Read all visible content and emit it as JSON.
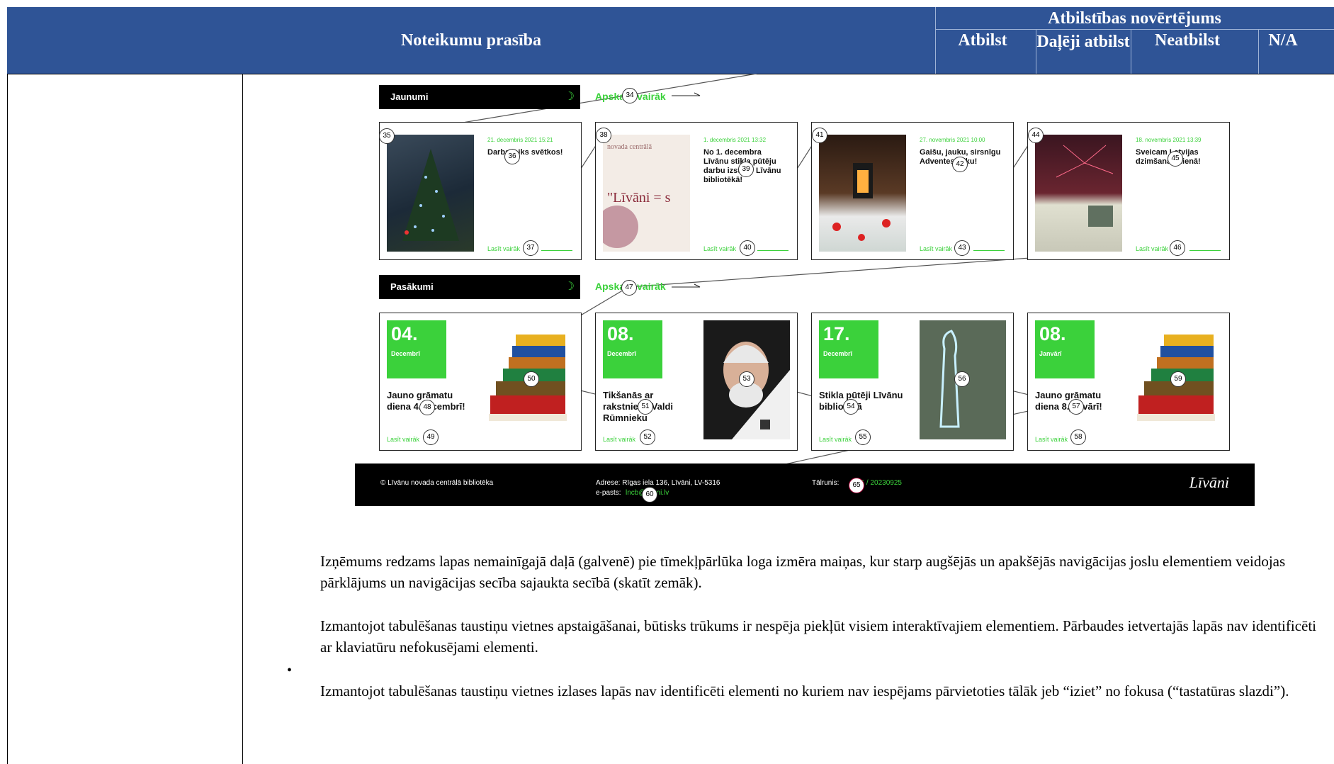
{
  "table_header": {
    "requirement": "Noteikumu prasība",
    "assessment": "Atbilstības novērtējums",
    "col_complies": "Atbilst",
    "col_partial": "Daļēji atbilst",
    "col_not": "Neatbilst",
    "col_na": "N/A"
  },
  "screenshot": {
    "news": {
      "section_label": "Jaunumi",
      "more_label": "Apskatīt vairāk",
      "cards": [
        {
          "date": "21. decembris 2021 15:21",
          "title": "Darba laiks svētkos!",
          "read_more": "Lasīt vairāk"
        },
        {
          "date": "1. decembris 2021 13:32",
          "title": "No 1. decembra Līvānu stikla pūtēju darbu izstāde Līvānu bibliotēkā!",
          "read_more": "Lasīt vairāk"
        },
        {
          "date": "27. novembris 2021 10:00",
          "title": "Gaišu, jauku, sirsnīgu Adventes laiku!",
          "read_more": "Lasīt vairāk"
        },
        {
          "date": "18. novembris 2021 13:39",
          "title": "Sveicam Latvijas dzimšanas dienā!",
          "read_more": "Lasīt vairāk"
        }
      ]
    },
    "events": {
      "section_label": "Pasākumi",
      "more_label": "Apskatīt vairāk",
      "cards": [
        {
          "day": "04.",
          "month": "Decembrī",
          "title": "Jauno grāmatu diena 4.decembrī!",
          "read_more": "Lasīt vairāk"
        },
        {
          "day": "08.",
          "month": "Decembrī",
          "title": "Tikšanās ar rakstnieku Valdi Rūmnieku",
          "read_more": "Lasīt vairāk"
        },
        {
          "day": "17.",
          "month": "Decembrī",
          "title": "Stikla pūtēji Līvānu bibliotēkā",
          "read_more": "Lasīt vairāk"
        },
        {
          "day": "08.",
          "month": "Janvārī",
          "title": "Jauno grāmatu diena 8.janvārī!",
          "read_more": "Lasīt vairāk"
        }
      ]
    },
    "footer": {
      "copyright": "© Līvānu novada centrālā bibliotēka",
      "address": "Adrese: Rīgas iela 136, Līvāni, LV-5316",
      "email_label": "e-pasts:",
      "email": "lncb@livani.lv",
      "phone_label": "Tālrunis:",
      "phone_tail": "85 / 20230925",
      "logo_text": "Līvāni"
    },
    "markers": [
      "34",
      "35",
      "36",
      "37",
      "38",
      "39",
      "40",
      "41",
      "42",
      "43",
      "44",
      "45",
      "46",
      "47",
      "48",
      "49",
      "50",
      "51",
      "52",
      "53",
      "54",
      "55",
      "56",
      "57",
      "58",
      "59",
      "60",
      "65"
    ]
  },
  "body": {
    "para1": "Izņēmums redzams lapas nemainīgajā daļā (galvenē) pie tīmekļpārlūka loga izmēra maiņas, kur starp augšējās un apakšējās navigācijas joslu elementiem veidojas pārklājums un navigācijas secība sajaukta secībā (skatīt zemāk).",
    "para2": "Izmantojot tabulēšanas taustiņu vietnes apstaigāšanai, būtisks trūkums ir nespēja piekļūt visiem interaktīvajiem elementiem. Pārbaudes ietvertajās lapās nav identificēti ar klaviatūru nefokusējami elementi.",
    "bullet1": "Izmantojot tabulēšanas taustiņu vietnes izlases lapās nav identificēti elementi no kuriem nav iespējams pārvietoties tālāk jeb “iziet” no fokusa (“tastatūras slazdi”)."
  },
  "colors": {
    "header_bg": "#2F5496",
    "accent_green": "#3bd13b"
  }
}
